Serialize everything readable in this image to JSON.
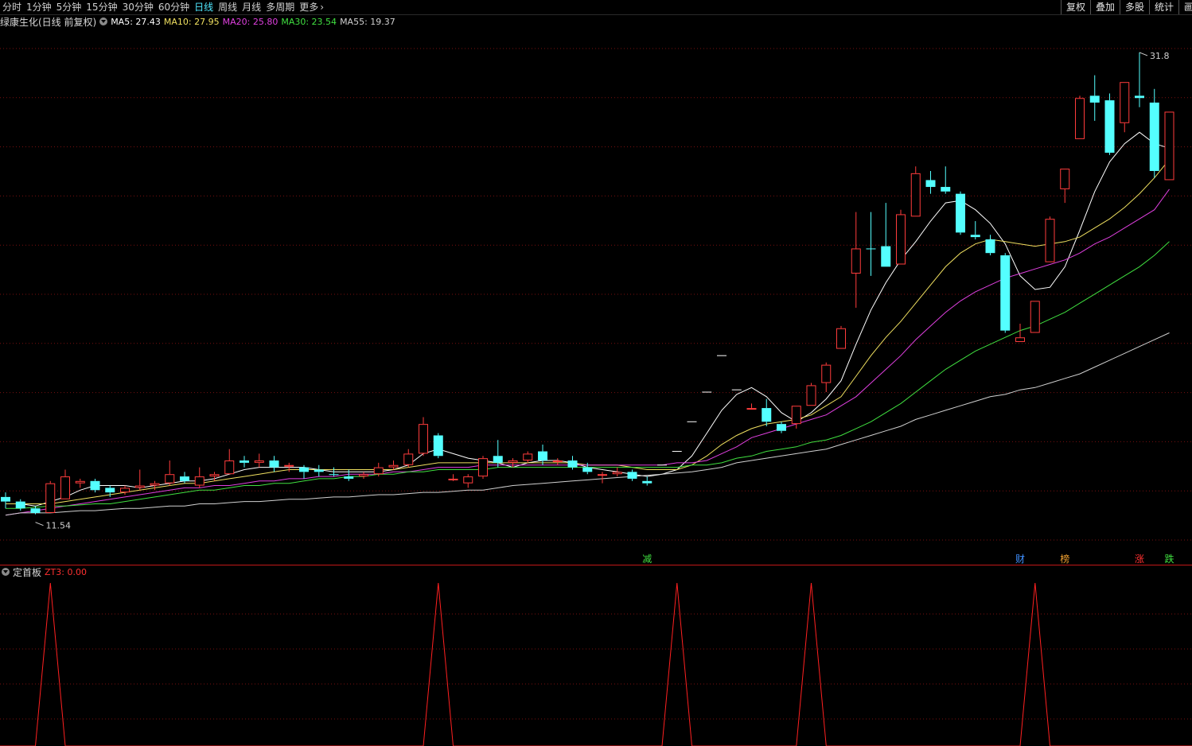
{
  "toolbar": {
    "periods": [
      "分时",
      "1分钟",
      "5分钟",
      "15分钟",
      "30分钟",
      "60分钟",
      "日线",
      "周线",
      "月线",
      "多周期",
      "更多"
    ],
    "active_period": "日线",
    "more_arrow": "›",
    "right_buttons": [
      "复权",
      "叠加",
      "多股",
      "统计",
      "画线"
    ]
  },
  "main_header": {
    "title": "绿康生化(日线 前复权)",
    "ma": [
      {
        "label": "MA5: 27.43",
        "color": "#ffffff"
      },
      {
        "label": "MA10: 27.95",
        "color": "#f0e060"
      },
      {
        "label": "MA20: 25.80",
        "color": "#e040e0"
      },
      {
        "label": "MA30: 23.54",
        "color": "#40e040"
      },
      {
        "label": "MA55: 19.37",
        "color": "#d0d0d0"
      }
    ]
  },
  "annotations": {
    "high_label": "31.8",
    "low_label": "11.54",
    "events": [
      {
        "label": "减",
        "color": "#40e040"
      },
      {
        "label": "财",
        "color": "#4090ff"
      },
      {
        "label": "榜",
        "color": "#f0a030"
      },
      {
        "label": "涨",
        "color": "#ff3030"
      },
      {
        "label": "跌",
        "color": "#40e040"
      }
    ]
  },
  "indicator_header": {
    "name": "定首板",
    "value_label": "ZT3: 0.00"
  },
  "colors": {
    "up": "#ff3c3c",
    "down": "#54ffff",
    "grid": "#7a1010",
    "divider": "#c01818"
  },
  "chart_data": {
    "type": "candlestick",
    "price_high": 31.8,
    "price_low": 11.54,
    "candles": [
      {
        "o": 12.3,
        "h": 12.5,
        "l": 11.8,
        "c": 12.1,
        "dir": "down"
      },
      {
        "o": 12.1,
        "h": 12.2,
        "l": 11.7,
        "c": 11.8,
        "dir": "down"
      },
      {
        "o": 11.8,
        "h": 11.9,
        "l": 11.54,
        "c": 11.6,
        "dir": "down"
      },
      {
        "o": 11.6,
        "h": 13.0,
        "l": 11.6,
        "c": 12.9,
        "dir": "up"
      },
      {
        "o": 12.2,
        "h": 13.5,
        "l": 12.2,
        "c": 13.2,
        "dir": "up"
      },
      {
        "o": 12.9,
        "h": 13.1,
        "l": 12.7,
        "c": 13.0,
        "dir": "up"
      },
      {
        "o": 13.0,
        "h": 13.1,
        "l": 12.5,
        "c": 12.6,
        "dir": "down"
      },
      {
        "o": 12.7,
        "h": 12.8,
        "l": 12.3,
        "c": 12.5,
        "dir": "down"
      },
      {
        "o": 12.5,
        "h": 12.8,
        "l": 12.4,
        "c": 12.7,
        "dir": "up"
      },
      {
        "o": 12.7,
        "h": 13.5,
        "l": 12.6,
        "c": 12.8,
        "dir": "up"
      },
      {
        "o": 12.8,
        "h": 13.0,
        "l": 12.6,
        "c": 12.9,
        "dir": "up"
      },
      {
        "o": 12.9,
        "h": 13.9,
        "l": 12.8,
        "c": 13.3,
        "dir": "up"
      },
      {
        "o": 13.2,
        "h": 13.4,
        "l": 12.9,
        "c": 13.0,
        "dir": "down"
      },
      {
        "o": 12.8,
        "h": 13.6,
        "l": 12.7,
        "c": 13.2,
        "dir": "up"
      },
      {
        "o": 13.2,
        "h": 13.4,
        "l": 13.0,
        "c": 13.3,
        "dir": "up"
      },
      {
        "o": 13.3,
        "h": 14.4,
        "l": 13.3,
        "c": 13.9,
        "dir": "up"
      },
      {
        "o": 13.8,
        "h": 14.1,
        "l": 13.6,
        "c": 13.9,
        "dir": "down"
      },
      {
        "o": 13.9,
        "h": 14.2,
        "l": 13.6,
        "c": 13.8,
        "dir": "up"
      },
      {
        "o": 13.9,
        "h": 14.1,
        "l": 13.4,
        "c": 13.6,
        "dir": "down"
      },
      {
        "o": 13.7,
        "h": 13.8,
        "l": 13.4,
        "c": 13.7,
        "dir": "up"
      },
      {
        "o": 13.6,
        "h": 13.7,
        "l": 13.1,
        "c": 13.4,
        "dir": "down"
      },
      {
        "o": 13.5,
        "h": 13.7,
        "l": 13.2,
        "c": 13.4,
        "dir": "down"
      },
      {
        "o": 13.3,
        "h": 13.6,
        "l": 13.2,
        "c": 13.3,
        "dir": "down"
      },
      {
        "o": 13.2,
        "h": 13.5,
        "l": 13.0,
        "c": 13.1,
        "dir": "down"
      },
      {
        "o": 13.2,
        "h": 13.4,
        "l": 13.1,
        "c": 13.3,
        "dir": "up"
      },
      {
        "o": 13.3,
        "h": 13.8,
        "l": 13.2,
        "c": 13.6,
        "dir": "up"
      },
      {
        "o": 13.6,
        "h": 13.9,
        "l": 13.5,
        "c": 13.7,
        "dir": "up"
      },
      {
        "o": 13.7,
        "h": 14.4,
        "l": 13.6,
        "c": 14.2,
        "dir": "up"
      },
      {
        "o": 14.2,
        "h": 15.8,
        "l": 14.1,
        "c": 15.5,
        "dir": "up"
      },
      {
        "o": 15.0,
        "h": 15.1,
        "l": 14.0,
        "c": 14.1,
        "dir": "down"
      },
      {
        "o": 13.1,
        "h": 13.3,
        "l": 13.0,
        "c": 13.1,
        "dir": "up"
      },
      {
        "o": 12.9,
        "h": 13.3,
        "l": 12.7,
        "c": 13.2,
        "dir": "up"
      },
      {
        "o": 13.2,
        "h": 14.1,
        "l": 13.1,
        "c": 14.0,
        "dir": "up"
      },
      {
        "o": 14.1,
        "h": 14.8,
        "l": 13.6,
        "c": 13.8,
        "dir": "down"
      },
      {
        "o": 13.8,
        "h": 14.0,
        "l": 13.6,
        "c": 13.9,
        "dir": "up"
      },
      {
        "o": 13.9,
        "h": 14.3,
        "l": 13.8,
        "c": 14.2,
        "dir": "up"
      },
      {
        "o": 14.3,
        "h": 14.6,
        "l": 13.7,
        "c": 13.9,
        "dir": "down"
      },
      {
        "o": 13.9,
        "h": 14.0,
        "l": 13.7,
        "c": 13.9,
        "dir": "up"
      },
      {
        "o": 13.9,
        "h": 14.1,
        "l": 13.5,
        "c": 13.6,
        "dir": "down"
      },
      {
        "o": 13.6,
        "h": 13.8,
        "l": 13.3,
        "c": 13.4,
        "dir": "down"
      },
      {
        "o": 13.3,
        "h": 13.4,
        "l": 12.9,
        "c": 13.3,
        "dir": "up"
      },
      {
        "o": 13.3,
        "h": 13.6,
        "l": 13.2,
        "c": 13.4,
        "dir": "up"
      },
      {
        "o": 13.4,
        "h": 13.5,
        "l": 13.0,
        "c": 13.1,
        "dir": "down"
      },
      {
        "o": 13.0,
        "h": 13.2,
        "l": 12.8,
        "c": 12.9,
        "dir": "down"
      },
      {
        "o": 13.7,
        "h": 13.7,
        "l": 13.7,
        "c": 13.7,
        "dir": "up"
      },
      {
        "o": 14.3,
        "h": 14.3,
        "l": 14.3,
        "c": 14.3,
        "dir": "up"
      },
      {
        "o": 15.6,
        "h": 15.6,
        "l": 15.6,
        "c": 15.6,
        "dir": "up"
      },
      {
        "o": 16.9,
        "h": 16.9,
        "l": 16.9,
        "c": 16.9,
        "dir": "up"
      },
      {
        "o": 18.5,
        "h": 18.5,
        "l": 18.5,
        "c": 18.5,
        "dir": "up"
      },
      {
        "o": 17.0,
        "h": 17.0,
        "l": 17.0,
        "c": 17.0,
        "dir": "up"
      },
      {
        "o": 16.2,
        "h": 16.4,
        "l": 16.2,
        "c": 16.2,
        "dir": "up"
      },
      {
        "o": 16.2,
        "h": 16.6,
        "l": 15.4,
        "c": 15.6,
        "dir": "down"
      },
      {
        "o": 15.5,
        "h": 15.6,
        "l": 15.1,
        "c": 15.2,
        "dir": "down"
      },
      {
        "o": 15.5,
        "h": 16.3,
        "l": 15.3,
        "c": 16.3,
        "dir": "up"
      },
      {
        "o": 16.3,
        "h": 17.3,
        "l": 16.3,
        "c": 17.2,
        "dir": "up"
      },
      {
        "o": 17.3,
        "h": 18.2,
        "l": 16.9,
        "c": 18.1,
        "dir": "up"
      },
      {
        "o": 18.8,
        "h": 19.8,
        "l": 18.8,
        "c": 19.7,
        "dir": "up"
      },
      {
        "o": 22.1,
        "h": 24.8,
        "l": 20.6,
        "c": 23.2,
        "dir": "up"
      },
      {
        "o": 23.2,
        "h": 24.8,
        "l": 22.0,
        "c": 23.2,
        "dir": "down"
      },
      {
        "o": 23.3,
        "h": 25.2,
        "l": 22.4,
        "c": 22.4,
        "dir": "down"
      },
      {
        "o": 22.5,
        "h": 24.9,
        "l": 22.5,
        "c": 24.7,
        "dir": "up"
      },
      {
        "o": 24.6,
        "h": 26.8,
        "l": 24.6,
        "c": 26.5,
        "dir": "up"
      },
      {
        "o": 26.2,
        "h": 26.6,
        "l": 25.6,
        "c": 25.9,
        "dir": "down"
      },
      {
        "o": 25.9,
        "h": 26.8,
        "l": 25.6,
        "c": 25.7,
        "dir": "down"
      },
      {
        "o": 25.6,
        "h": 25.7,
        "l": 23.8,
        "c": 23.9,
        "dir": "down"
      },
      {
        "o": 23.8,
        "h": 24.4,
        "l": 23.6,
        "c": 23.7,
        "dir": "down"
      },
      {
        "o": 23.6,
        "h": 23.8,
        "l": 22.9,
        "c": 23.0,
        "dir": "down"
      },
      {
        "o": 22.9,
        "h": 23.0,
        "l": 19.5,
        "c": 19.6,
        "dir": "down"
      },
      {
        "o": 19.1,
        "h": 19.9,
        "l": 19.1,
        "c": 19.3,
        "dir": "up"
      },
      {
        "o": 19.5,
        "h": 20.9,
        "l": 19.5,
        "c": 20.9,
        "dir": "up"
      },
      {
        "o": 22.6,
        "h": 24.6,
        "l": 22.6,
        "c": 24.5,
        "dir": "up"
      },
      {
        "o": 25.8,
        "h": 26.7,
        "l": 25.2,
        "c": 26.7,
        "dir": "up"
      },
      {
        "o": 28.0,
        "h": 29.9,
        "l": 28.0,
        "c": 29.8,
        "dir": "up"
      },
      {
        "o": 29.9,
        "h": 30.8,
        "l": 28.8,
        "c": 29.6,
        "dir": "down"
      },
      {
        "o": 29.7,
        "h": 30.0,
        "l": 27.3,
        "c": 27.4,
        "dir": "down"
      },
      {
        "o": 28.7,
        "h": 30.5,
        "l": 28.3,
        "c": 30.5,
        "dir": "up"
      },
      {
        "o": 29.8,
        "h": 31.8,
        "l": 29.4,
        "c": 29.9,
        "dir": "down"
      },
      {
        "o": 29.6,
        "h": 30.2,
        "l": 26.3,
        "c": 26.6,
        "dir": "down"
      },
      {
        "o": 26.2,
        "h": 29.2,
        "l": 26.2,
        "c": 29.2,
        "dir": "up"
      }
    ],
    "ma_lines": [
      {
        "name": "MA5",
        "color": "#ffffff",
        "values": [
          12.0,
          12.0,
          11.9,
          12.1,
          12.3,
          12.6,
          12.8,
          12.8,
          12.8,
          12.7,
          12.8,
          12.9,
          13.0,
          13.0,
          13.1,
          13.3,
          13.5,
          13.6,
          13.6,
          13.6,
          13.6,
          13.5,
          13.4,
          13.4,
          13.4,
          13.4,
          13.5,
          13.7,
          14.2,
          14.4,
          14.2,
          14.0,
          13.9,
          13.8,
          13.6,
          13.8,
          13.9,
          13.9,
          13.8,
          13.6,
          13.5,
          13.4,
          13.3,
          13.2,
          13.3,
          13.5,
          14.1,
          15.1,
          16.1,
          16.8,
          17.1,
          16.7,
          16.0,
          15.6,
          16.0,
          16.6,
          17.4,
          19.0,
          20.5,
          21.7,
          22.7,
          23.5,
          24.4,
          25.2,
          25.3,
          24.9,
          24.3,
          23.4,
          22.0,
          21.4,
          21.5,
          22.4,
          24.0,
          25.7,
          27.0,
          27.8,
          28.3,
          27.8,
          27.6
        ]
      },
      {
        "name": "MA10",
        "color": "#f0e060",
        "values": [
          12.0,
          12.0,
          12.0,
          12.0,
          12.1,
          12.2,
          12.3,
          12.4,
          12.5,
          12.6,
          12.7,
          12.8,
          12.9,
          12.9,
          13.0,
          13.1,
          13.2,
          13.3,
          13.4,
          13.5,
          13.5,
          13.5,
          13.5,
          13.5,
          13.5,
          13.5,
          13.5,
          13.6,
          13.7,
          13.8,
          13.8,
          13.8,
          13.8,
          13.8,
          13.8,
          13.8,
          13.8,
          13.8,
          13.8,
          13.7,
          13.7,
          13.7,
          13.6,
          13.5,
          13.5,
          13.5,
          13.7,
          14.1,
          14.6,
          15.0,
          15.3,
          15.5,
          15.6,
          15.7,
          15.9,
          16.3,
          16.7,
          17.6,
          18.5,
          19.3,
          20.0,
          20.8,
          21.6,
          22.4,
          23.0,
          23.4,
          23.6,
          23.5,
          23.4,
          23.3,
          23.4,
          23.5,
          23.7,
          24.1,
          24.5,
          25.0,
          25.6,
          26.3,
          27.1
        ]
      },
      {
        "name": "MA20",
        "color": "#e040e0",
        "values": [
          11.5,
          11.6,
          11.7,
          11.8,
          11.9,
          12.0,
          12.1,
          12.2,
          12.3,
          12.4,
          12.5,
          12.6,
          12.7,
          12.7,
          12.8,
          12.8,
          12.9,
          13.0,
          13.0,
          13.1,
          13.1,
          13.2,
          13.2,
          13.3,
          13.3,
          13.3,
          13.4,
          13.4,
          13.5,
          13.6,
          13.6,
          13.6,
          13.7,
          13.7,
          13.7,
          13.7,
          13.7,
          13.7,
          13.7,
          13.7,
          13.7,
          13.7,
          13.7,
          13.7,
          13.7,
          13.8,
          13.8,
          13.9,
          14.2,
          14.5,
          14.9,
          15.1,
          15.3,
          15.5,
          15.7,
          15.9,
          16.3,
          16.7,
          17.3,
          17.9,
          18.5,
          19.2,
          19.8,
          20.4,
          20.9,
          21.3,
          21.6,
          21.9,
          22.1,
          22.3,
          22.5,
          22.7,
          23.0,
          23.4,
          23.7,
          24.1,
          24.5,
          24.9,
          25.8
        ]
      },
      {
        "name": "MA30",
        "color": "#40e040",
        "values": [
          11.8,
          11.8,
          11.85,
          11.9,
          11.9,
          11.95,
          12.0,
          12.0,
          12.1,
          12.2,
          12.3,
          12.4,
          12.5,
          12.6,
          12.6,
          12.7,
          12.8,
          12.8,
          12.9,
          12.9,
          13.0,
          13.1,
          13.1,
          13.2,
          13.2,
          13.3,
          13.3,
          13.4,
          13.4,
          13.5,
          13.5,
          13.5,
          13.5,
          13.6,
          13.6,
          13.6,
          13.6,
          13.6,
          13.6,
          13.6,
          13.6,
          13.6,
          13.6,
          13.6,
          13.6,
          13.6,
          13.7,
          13.7,
          13.8,
          14.0,
          14.1,
          14.3,
          14.4,
          14.5,
          14.7,
          14.8,
          15.0,
          15.3,
          15.6,
          16.0,
          16.4,
          16.9,
          17.4,
          17.9,
          18.3,
          18.7,
          19.0,
          19.3,
          19.6,
          19.8,
          20.1,
          20.4,
          20.8,
          21.2,
          21.6,
          22.0,
          22.4,
          22.9,
          23.5
        ]
      },
      {
        "name": "MA55",
        "color": "#d0d0d0",
        "values": [
          11.5,
          11.6,
          11.6,
          11.6,
          11.65,
          11.7,
          11.7,
          11.75,
          11.8,
          11.8,
          11.85,
          11.9,
          11.9,
          12.0,
          12.0,
          12.05,
          12.1,
          12.1,
          12.15,
          12.2,
          12.2,
          12.25,
          12.3,
          12.3,
          12.35,
          12.4,
          12.4,
          12.45,
          12.5,
          12.5,
          12.55,
          12.6,
          12.6,
          12.7,
          12.8,
          12.85,
          12.9,
          12.95,
          13.0,
          13.05,
          13.1,
          13.15,
          13.2,
          13.25,
          13.3,
          13.35,
          13.4,
          13.5,
          13.6,
          13.8,
          13.9,
          14.0,
          14.1,
          14.2,
          14.3,
          14.4,
          14.6,
          14.8,
          15.0,
          15.2,
          15.4,
          15.7,
          15.9,
          16.1,
          16.3,
          16.5,
          16.7,
          16.8,
          17.0,
          17.1,
          17.3,
          17.5,
          17.7,
          18.0,
          18.3,
          18.6,
          18.9,
          19.2,
          19.5
        ]
      }
    ],
    "event_markers": [
      {
        "label": "减",
        "index": 43
      },
      {
        "label": "财",
        "index": 68
      },
      {
        "label": "榜",
        "index": 71
      },
      {
        "label": "涨",
        "index": 76
      },
      {
        "label": "跌",
        "index": 78
      }
    ]
  },
  "indicator_data": {
    "name": "ZT3",
    "peaks_at_index": [
      3,
      29,
      45,
      54,
      69
    ],
    "peak_value": 1,
    "base_value": 0
  }
}
